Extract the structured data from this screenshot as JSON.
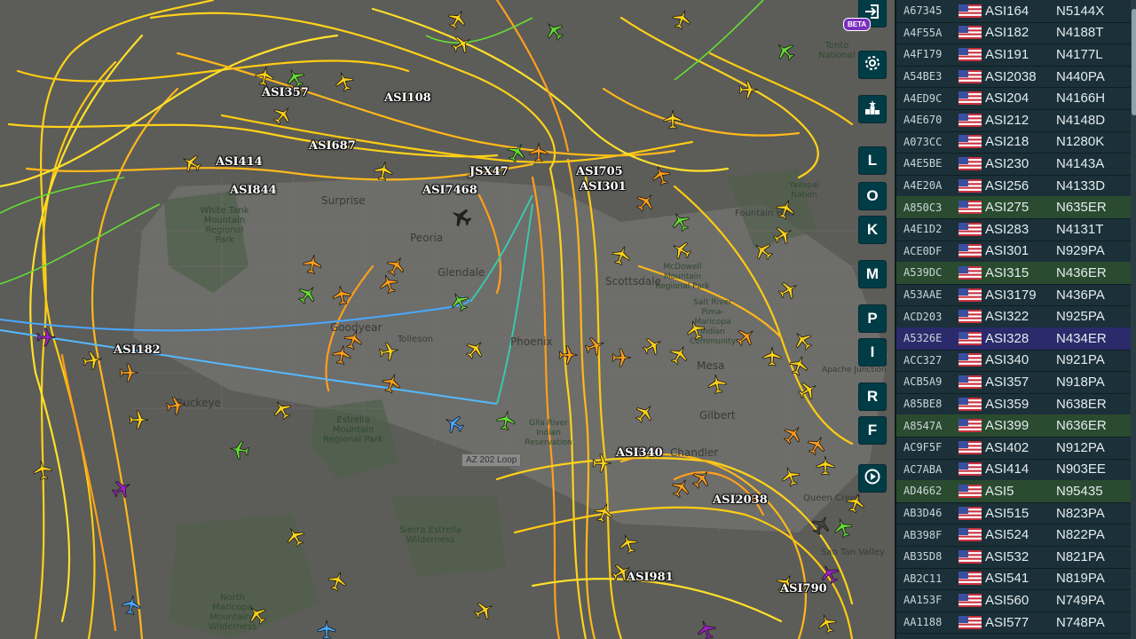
{
  "map": {
    "cities": [
      "Surprise",
      "Peoria",
      "Glendale",
      "Scottsdale",
      "Phoenix",
      "Goodyear",
      "Tolleson",
      "Buckeye",
      "Mesa",
      "Gilbert",
      "Chandler",
      "Fountain Hills",
      "Queen Creek",
      "San Tan Valley",
      "Apache Junction"
    ],
    "parks": [
      "White Tank Mountain Regional Park",
      "Estrella Mountain Regional Park",
      "Sierra Estrella Wilderness",
      "North Maricopa Mountains Wilderness",
      "McDowell Mountain Regional Park",
      "Yavapai Nation",
      "Tonto National",
      "Salt River Pima-Maricopa Indian Community",
      "Gila River Indian Reservation"
    ],
    "road_shield": "AZ 202 Loop",
    "flight_labels": [
      "ASI357",
      "ASI108",
      "ASI687",
      "ASI414",
      "ASI844",
      "ASI7468",
      "JSX47",
      "ASI705",
      "ASI301",
      "ASI182",
      "ASI340",
      "ASI2038",
      "ASI981",
      "ASI790"
    ]
  },
  "controls": {
    "beta_badge": "BETA",
    "layer_buttons": [
      "L",
      "O",
      "K",
      "M",
      "P",
      "I",
      "R",
      "F"
    ],
    "icons": [
      "login-icon",
      "settings-icon",
      "leaderboard-icon",
      "replay-icon"
    ]
  },
  "aircraft_table": {
    "rows": [
      {
        "hex": "A67345",
        "callsign": "ASI164",
        "reg": "N5144X",
        "state": "normal"
      },
      {
        "hex": "A4F55A",
        "callsign": "ASI182",
        "reg": "N4188T",
        "state": "normal"
      },
      {
        "hex": "A4F179",
        "callsign": "ASI191",
        "reg": "N4177L",
        "state": "normal"
      },
      {
        "hex": "A54BE3",
        "callsign": "ASI2038",
        "reg": "N440PA",
        "state": "normal"
      },
      {
        "hex": "A4ED9C",
        "callsign": "ASI204",
        "reg": "N4166H",
        "state": "normal"
      },
      {
        "hex": "A4E670",
        "callsign": "ASI212",
        "reg": "N4148D",
        "state": "normal"
      },
      {
        "hex": "A073CC",
        "callsign": "ASI218",
        "reg": "N1280K",
        "state": "normal"
      },
      {
        "hex": "A4E5BE",
        "callsign": "ASI230",
        "reg": "N4143A",
        "state": "normal"
      },
      {
        "hex": "A4E20A",
        "callsign": "ASI256",
        "reg": "N4133D",
        "state": "normal"
      },
      {
        "hex": "A850C3",
        "callsign": "ASI275",
        "reg": "N635ER",
        "state": "alt"
      },
      {
        "hex": "A4E1D2",
        "callsign": "ASI283",
        "reg": "N4131T",
        "state": "normal"
      },
      {
        "hex": "ACE0DF",
        "callsign": "ASI301",
        "reg": "N929PA",
        "state": "normal"
      },
      {
        "hex": "A539DC",
        "callsign": "ASI315",
        "reg": "N436ER",
        "state": "alt"
      },
      {
        "hex": "A53AAE",
        "callsign": "ASI3179",
        "reg": "N436PA",
        "state": "normal"
      },
      {
        "hex": "ACD203",
        "callsign": "ASI322",
        "reg": "N925PA",
        "state": "normal"
      },
      {
        "hex": "A5326E",
        "callsign": "ASI328",
        "reg": "N434ER",
        "state": "sel"
      },
      {
        "hex": "ACC327",
        "callsign": "ASI340",
        "reg": "N921PA",
        "state": "normal"
      },
      {
        "hex": "ACB5A9",
        "callsign": "ASI357",
        "reg": "N918PA",
        "state": "normal"
      },
      {
        "hex": "A85BE8",
        "callsign": "ASI359",
        "reg": "N638ER",
        "state": "normal"
      },
      {
        "hex": "A8547A",
        "callsign": "ASI399",
        "reg": "N636ER",
        "state": "alt"
      },
      {
        "hex": "AC9F5F",
        "callsign": "ASI402",
        "reg": "N912PA",
        "state": "normal"
      },
      {
        "hex": "AC7ABA",
        "callsign": "ASI414",
        "reg": "N903EE",
        "state": "normal"
      },
      {
        "hex": "AD4662",
        "callsign": "ASI5",
        "reg": "N95435",
        "state": "alt"
      },
      {
        "hex": "AB3D46",
        "callsign": "ASI515",
        "reg": "N823PA",
        "state": "normal"
      },
      {
        "hex": "AB398F",
        "callsign": "ASI524",
        "reg": "N822PA",
        "state": "normal"
      },
      {
        "hex": "AB35D8",
        "callsign": "ASI532",
        "reg": "N821PA",
        "state": "normal"
      },
      {
        "hex": "AB2C11",
        "callsign": "ASI541",
        "reg": "N819PA",
        "state": "normal"
      },
      {
        "hex": "AA153F",
        "callsign": "ASI560",
        "reg": "N749PA",
        "state": "normal"
      },
      {
        "hex": "AA1188",
        "callsign": "ASI577",
        "reg": "N748PA",
        "state": "normal"
      }
    ]
  },
  "colors": {
    "track_yellow": "#ffd21a",
    "track_orange": "#ff9f1a",
    "track_green": "#66dd33",
    "track_blue": "#4aa8ff",
    "selected_row": "#2b2a6b",
    "highlight_row": "#2a4b2f",
    "control_button": "#003c46"
  }
}
